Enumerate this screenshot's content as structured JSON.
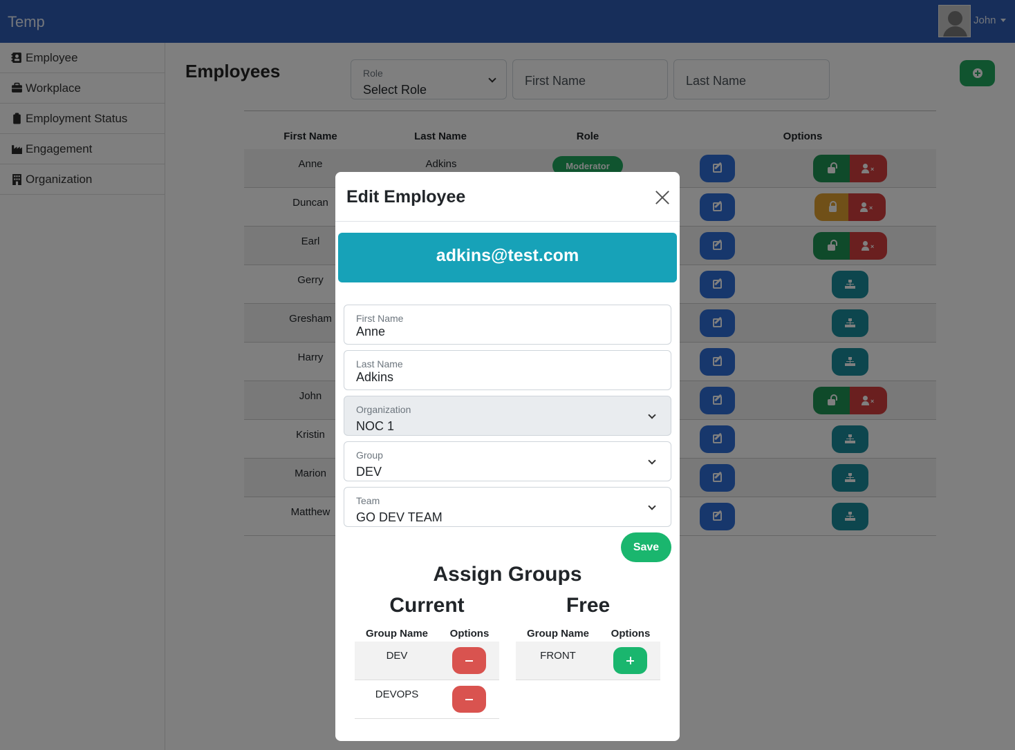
{
  "app": {
    "brand": "Temp",
    "user_name": "John"
  },
  "sidebar": {
    "items": [
      {
        "label": "Employee",
        "icon": "address-card-icon"
      },
      {
        "label": "Workplace",
        "icon": "briefcase-icon"
      },
      {
        "label": "Employment Status",
        "icon": "clipboard-icon"
      },
      {
        "label": "Engagement",
        "icon": "industry-icon"
      },
      {
        "label": "Organization",
        "icon": "building-icon"
      }
    ]
  },
  "main": {
    "title": "Employees",
    "filters": {
      "role_label": "Role",
      "role_value": "Select Role",
      "first_name_placeholder": "First Name",
      "last_name_placeholder": "Last Name"
    },
    "table": {
      "headers": [
        "First Name",
        "Last Name",
        "Role",
        "Options"
      ],
      "rows": [
        {
          "first": "Anne",
          "last": "Adkins",
          "role": "Moderator"
        },
        {
          "first": "Duncan",
          "last": "",
          "role": ""
        },
        {
          "first": "Earl",
          "last": "",
          "role": ""
        },
        {
          "first": "Gerry",
          "last": "",
          "role": ""
        },
        {
          "first": "Gresham",
          "last": "",
          "role": ""
        },
        {
          "first": "Harry",
          "last": "",
          "role": ""
        },
        {
          "first": "John",
          "last": "",
          "role": ""
        },
        {
          "first": "Kristin",
          "last": "",
          "role": ""
        },
        {
          "first": "Marion",
          "last": "",
          "role": ""
        },
        {
          "first": "Matthew",
          "last": "",
          "role": ""
        }
      ]
    }
  },
  "modal": {
    "title": "Edit Employee",
    "email": "adkins@test.com",
    "fields": {
      "first_name": {
        "label": "First Name",
        "value": "Anne"
      },
      "last_name": {
        "label": "Last Name",
        "value": "Adkins"
      },
      "organization": {
        "label": "Organization",
        "value": "NOC 1"
      },
      "group": {
        "label": "Group",
        "value": "DEV"
      },
      "team": {
        "label": "Team",
        "value": "GO DEV TEAM"
      }
    },
    "save_label": "Save",
    "assign_title": "Assign Groups",
    "current": {
      "title": "Current",
      "headers": [
        "Group Name",
        "Options"
      ],
      "rows": [
        "DEV",
        "DEVOPS"
      ]
    },
    "free": {
      "title": "Free",
      "headers": [
        "Group Name",
        "Options"
      ],
      "rows": [
        "FRONT"
      ]
    }
  },
  "colors": {
    "navbar": "#2f5db5",
    "success": "#20a85f",
    "edit": "#2f6ed9",
    "danger": "#d43f3f",
    "warning": "#e0a030",
    "info": "#17a2b8",
    "org": "#1a8c9c"
  }
}
